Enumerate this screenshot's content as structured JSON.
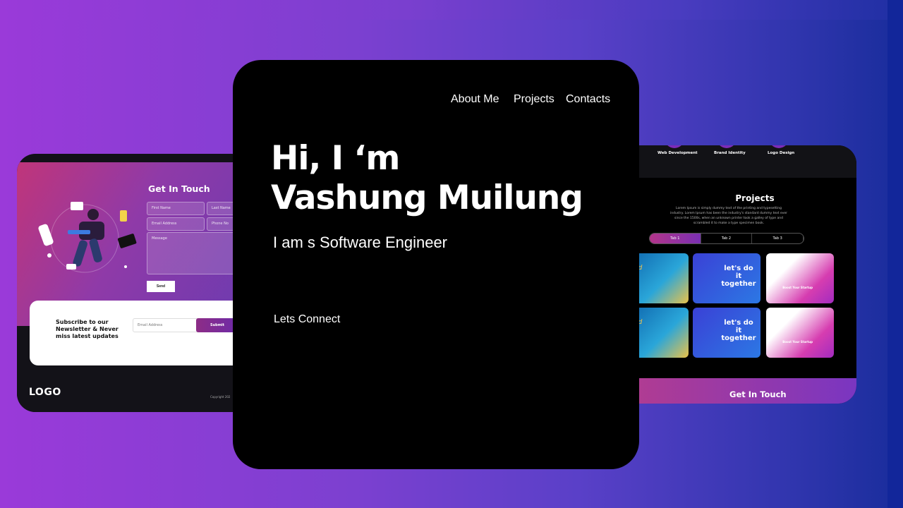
{
  "main": {
    "nav": [
      "About Me",
      "Projects",
      "Contacts"
    ],
    "hero_line1": "Hi, I ‘m",
    "hero_line2": "Vashung Muilung",
    "role": "I am s Software Engineer",
    "cta": "Lets Connect"
  },
  "left_card": {
    "title": "Get In Touch",
    "fields": {
      "first_name": "First Name",
      "last_name": "Last Name",
      "email": "Email Address",
      "phone": "Phone No",
      "message": "Message"
    },
    "send": "Send",
    "subscribe_text": "Subscribe to our Newsletter & Never miss latest updates",
    "subscribe_placeholder": "Email Address",
    "submit": "Submit",
    "logo": "LOGO",
    "copyright": "Copyright 202"
  },
  "right_card": {
    "services": [
      "Web Development",
      "Brand Identity",
      "Logo Design"
    ],
    "projects_title": "Projects",
    "projects_desc": "Lorem Ipsum is simply dummy text of the printing and typesetting industry. Lorem Ipsum has been the industry's standard dummy text ever since the 1500s, when an unknown printer took a galley of type and scrambled it to make a type specimen book.",
    "tabs": [
      "Tab 1",
      "Tab 2",
      "Tab 3"
    ],
    "thumb_text": {
      "world": "World",
      "together": "let's do it together",
      "boost": "Boost Your Startup"
    },
    "footer_title": "Get In Touch"
  },
  "colors": {
    "accent_pink": "#b43c8f",
    "accent_purple": "#7a36c1",
    "background_start": "#9a3ad9",
    "background_end": "#1c2e9e"
  }
}
